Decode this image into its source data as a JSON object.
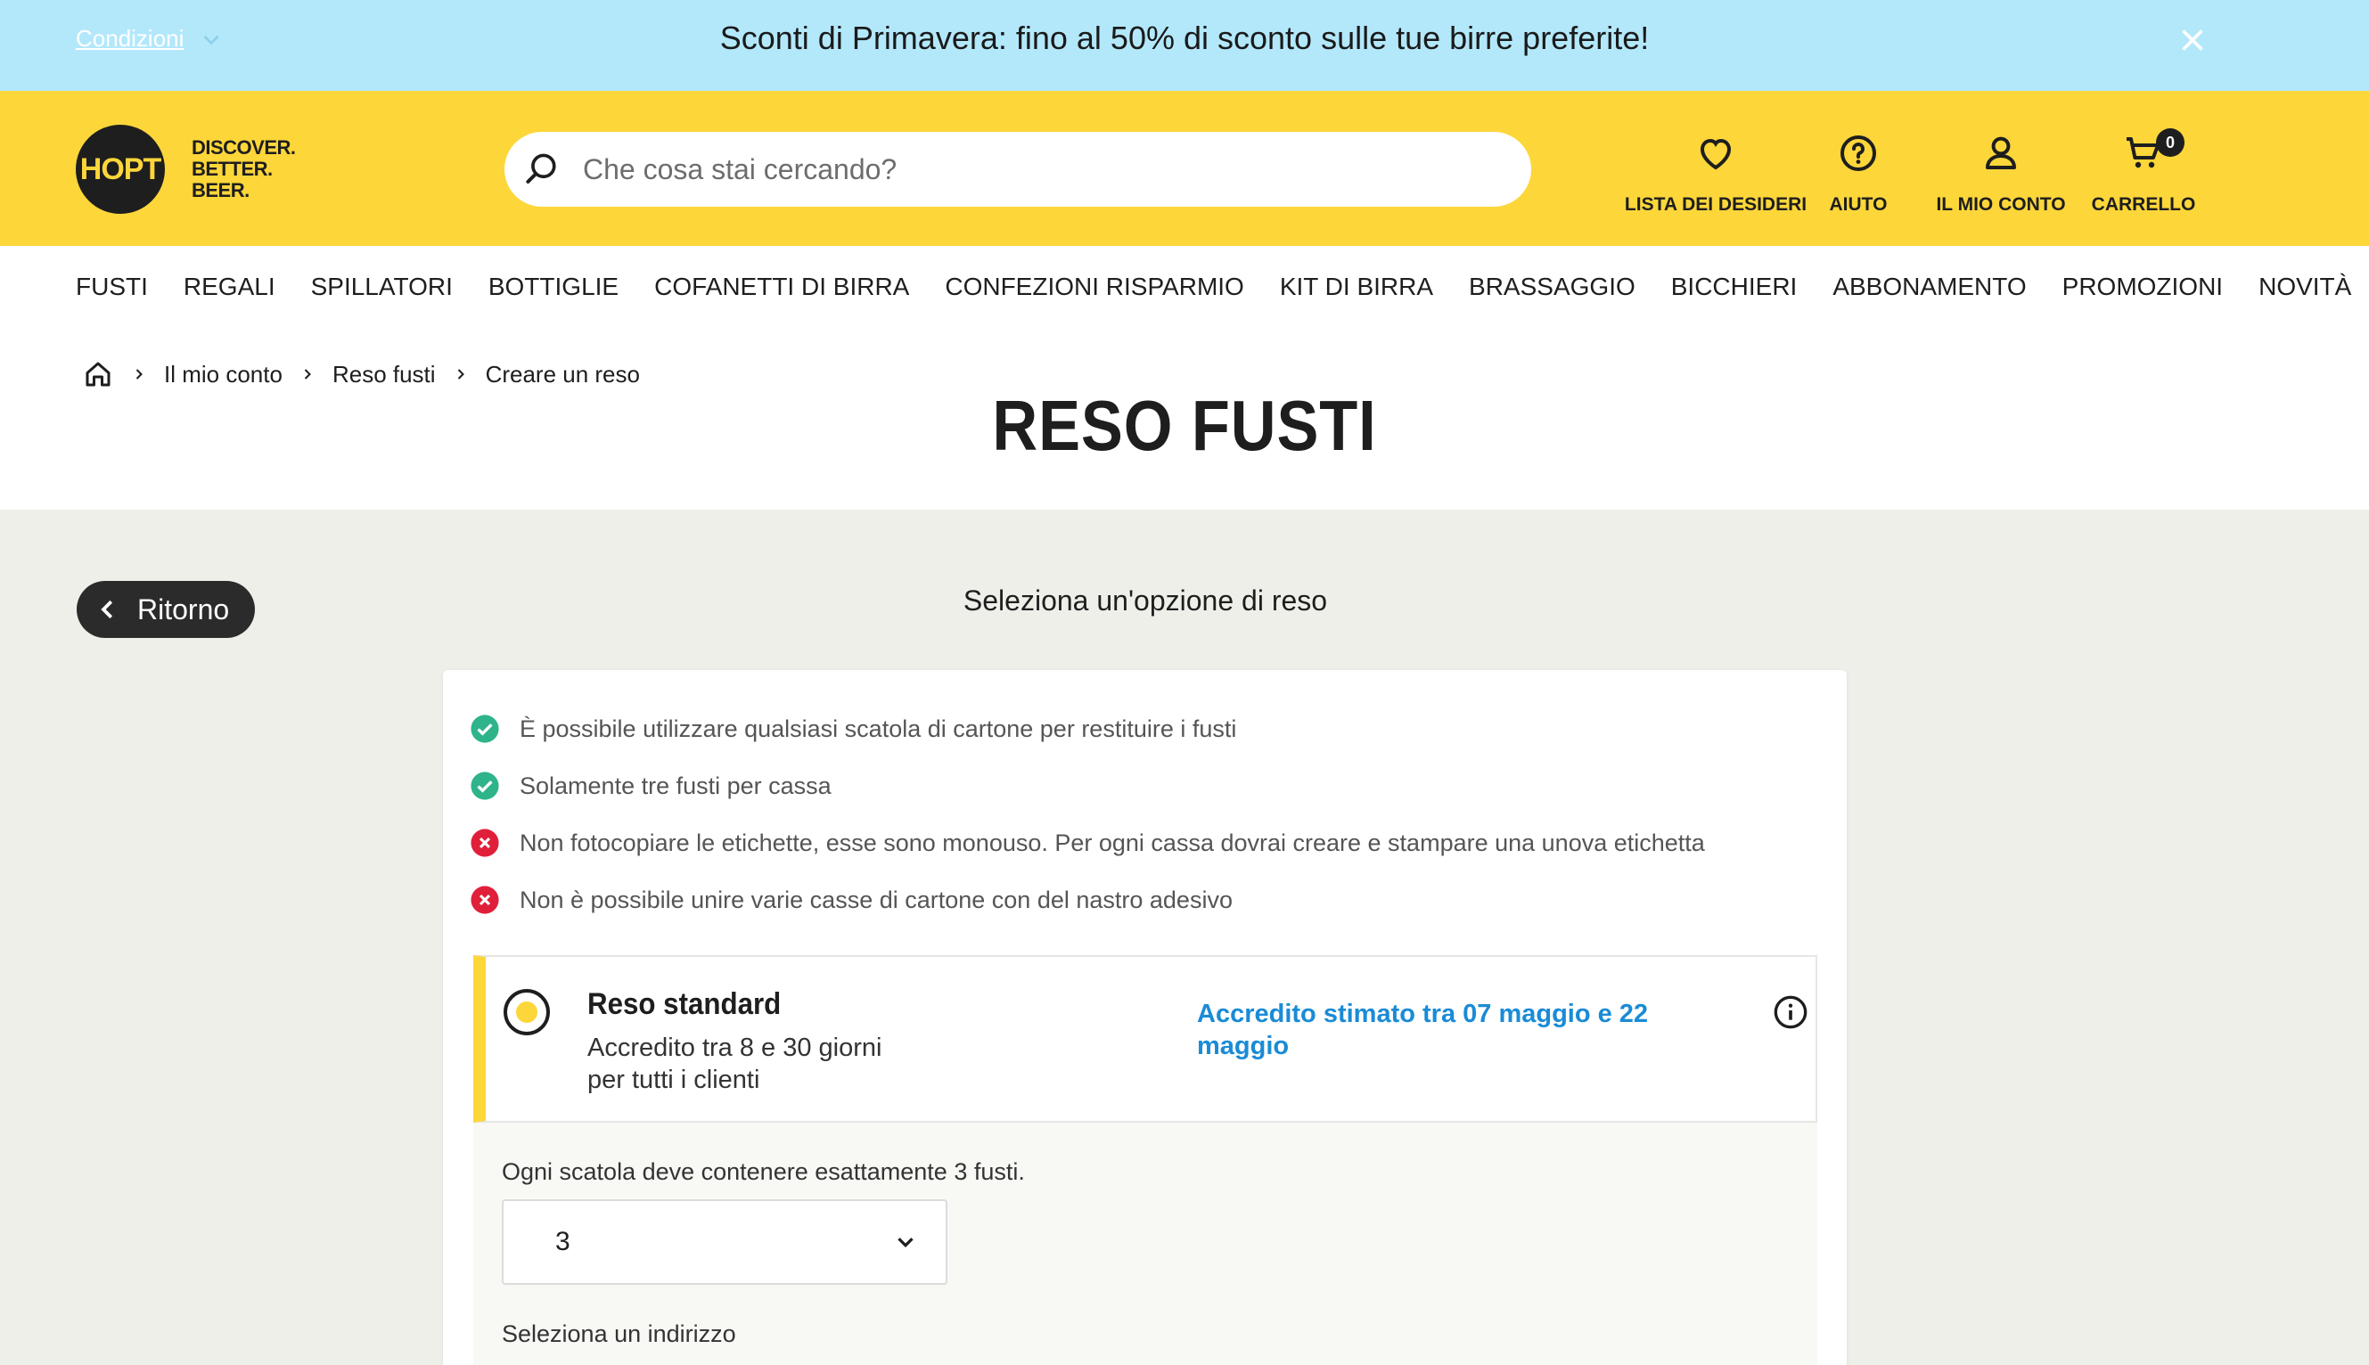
{
  "promo": {
    "conditions": "Condizioni",
    "message": "Sconti di Primavera: fino al 50% di sconto sulle tue birre preferite!"
  },
  "header": {
    "logo_text": "HOPT",
    "tagline": [
      "DISCOVER.",
      "BETTER.",
      "BEER."
    ],
    "search_placeholder": "Che cosa stai cercando?",
    "icons": [
      {
        "name": "heart-icon",
        "label": "LISTA DEI DESIDERI"
      },
      {
        "name": "help-icon",
        "label": "AIUTO"
      },
      {
        "name": "user-icon",
        "label": "IL MIO CONTO"
      },
      {
        "name": "cart-icon",
        "label": "CARRELLO",
        "badge": "0"
      }
    ],
    "accent_color": "#fdd63a"
  },
  "nav": {
    "items": [
      "FUSTI",
      "REGALI",
      "SPILLATORI",
      "BOTTIGLIE",
      "COFANETTI DI BIRRA",
      "CONFEZIONI RISPARMIO",
      "KIT DI BIRRA",
      "BRASSAGGIO",
      "BICCHIERI",
      "ABBONAMENTO",
      "PROMOZIONI",
      "NOVITÀ"
    ]
  },
  "breadcrumb": [
    "Il mio conto",
    "Reso fusti",
    "Creare un reso"
  ],
  "page_title": "RESO FUSTI",
  "main": {
    "back_label": "Ritorno",
    "subtitle": "Seleziona un'opzione di reso",
    "rules": [
      {
        "type": "ok",
        "text": "È possibile utilizzare qualsiasi scatola di cartone per restituire i fusti"
      },
      {
        "type": "ok",
        "text": "Solamente tre fusti per cassa"
      },
      {
        "type": "no",
        "text": "Non fotocopiare le etichette, esse sono monouso. Per ogni cassa dovrai creare e stampare una unova etichetta"
      },
      {
        "type": "no",
        "text": "Non è possibile unire varie casse di cartone con del nastro adesivo"
      }
    ],
    "option": {
      "title": "Reso standard",
      "desc_line1": "Accredito tra 8 e 30 giorni",
      "desc_line2": "per tutti i clienti",
      "credit": "Accredito stimato tra 07 maggio e 22 maggio"
    },
    "box_note": "Ogni scatola deve contenere esattamente 3 fusti.",
    "quantity_value": "3",
    "address_label": "Seleziona un indirizzo"
  }
}
